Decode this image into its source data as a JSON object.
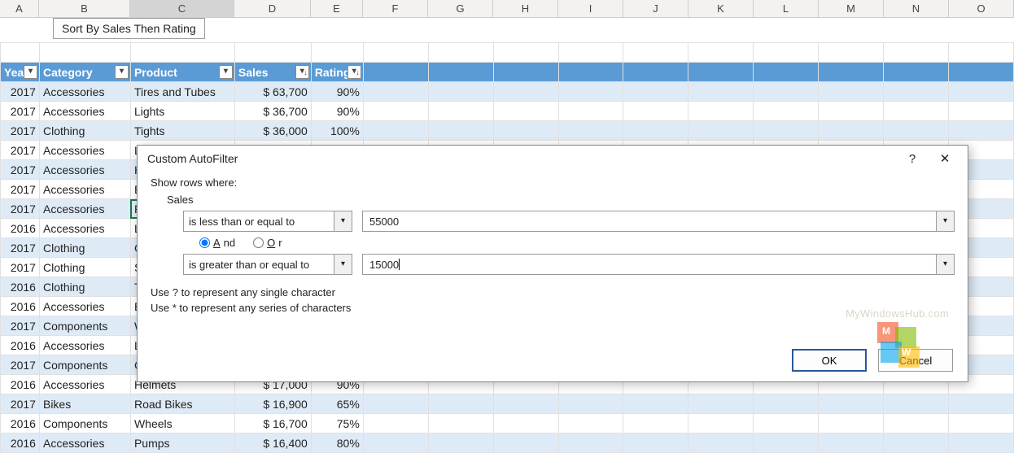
{
  "columns": [
    "A",
    "B",
    "C",
    "D",
    "E",
    "F",
    "G",
    "H",
    "I",
    "J",
    "K",
    "L",
    "M",
    "N",
    "O"
  ],
  "sort_button": "Sort By Sales Then Rating",
  "headers": {
    "year": "Year",
    "category": "Category",
    "product": "Product",
    "sales": "Sales",
    "rating": "Rating"
  },
  "rows": [
    {
      "year": "2017",
      "category": "Accessories",
      "product": "Tires and Tubes",
      "sales": "$ 63,700",
      "rating": "90%"
    },
    {
      "year": "2017",
      "category": "Accessories",
      "product": "Lights",
      "sales": "$ 36,700",
      "rating": "90%"
    },
    {
      "year": "2017",
      "category": "Clothing",
      "product": "Tights",
      "sales": "$ 36,000",
      "rating": "100%"
    },
    {
      "year": "2017",
      "category": "Accessories",
      "product": "L",
      "sales": "",
      "rating": ""
    },
    {
      "year": "2017",
      "category": "Accessories",
      "product": "H",
      "sales": "",
      "rating": ""
    },
    {
      "year": "2017",
      "category": "Accessories",
      "product": "Bi",
      "sales": "",
      "rating": ""
    },
    {
      "year": "2017",
      "category": "Accessories",
      "product": "P",
      "sales": "",
      "rating": ""
    },
    {
      "year": "2016",
      "category": "Accessories",
      "product": "L",
      "sales": "",
      "rating": ""
    },
    {
      "year": "2017",
      "category": "Clothing",
      "product": "G",
      "sales": "",
      "rating": ""
    },
    {
      "year": "2017",
      "category": "Clothing",
      "product": "Sh",
      "sales": "",
      "rating": ""
    },
    {
      "year": "2016",
      "category": "Clothing",
      "product": "Ti",
      "sales": "",
      "rating": ""
    },
    {
      "year": "2016",
      "category": "Accessories",
      "product": "Bi",
      "sales": "",
      "rating": ""
    },
    {
      "year": "2017",
      "category": "Components",
      "product": "W",
      "sales": "",
      "rating": ""
    },
    {
      "year": "2016",
      "category": "Accessories",
      "product": "Li",
      "sales": "",
      "rating": ""
    },
    {
      "year": "2017",
      "category": "Components",
      "product": "Cl",
      "sales": "",
      "rating": ""
    },
    {
      "year": "2016",
      "category": "Accessories",
      "product": "Helmets",
      "sales": "$ 17,000",
      "rating": "90%"
    },
    {
      "year": "2017",
      "category": "Bikes",
      "product": "Road Bikes",
      "sales": "$ 16,900",
      "rating": "65%"
    },
    {
      "year": "2016",
      "category": "Components",
      "product": "Wheels",
      "sales": "$ 16,700",
      "rating": "75%"
    },
    {
      "year": "2016",
      "category": "Accessories",
      "product": "Pumps",
      "sales": "$ 16,400",
      "rating": "80%"
    }
  ],
  "dialog": {
    "title": "Custom AutoFilter",
    "show_label": "Show rows where:",
    "field": "Sales",
    "op1": "is less than or equal to",
    "val1": "55000",
    "and": "And",
    "or": "Or",
    "op2": "is greater than or equal to",
    "val2": "15000",
    "hint1": "Use ? to represent any single character",
    "hint2": "Use * to represent any series of characters",
    "ok": "OK",
    "cancel": "Cancel",
    "help": "?",
    "close": "✕"
  },
  "watermark": "MyWindowsHub.com"
}
